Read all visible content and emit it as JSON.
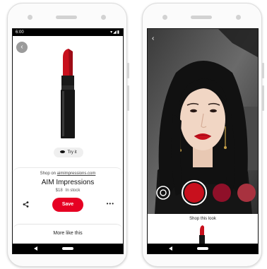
{
  "left_phone": {
    "status": {
      "time": "6:00",
      "icons": "▾◢▮"
    },
    "back_icon": "chevron-left-icon",
    "product_image": "red-lipstick",
    "try_it_label": "Try it",
    "shop_prefix": "Shop on",
    "shop_domain": "aimimpressions.com",
    "title": "AIM Impressions",
    "price": "$18",
    "stock": "In stock",
    "save_label": "Save",
    "more_like_label": "More like this"
  },
  "right_phone": {
    "back_icon": "chevron-left-icon",
    "shop_look_label": "Shop this look",
    "swatches": [
      "#c8101d",
      "#8f1029",
      "#a8323f"
    ]
  },
  "colors": {
    "brand_red": "#e60023",
    "lipstick_red": "#c8101d"
  }
}
